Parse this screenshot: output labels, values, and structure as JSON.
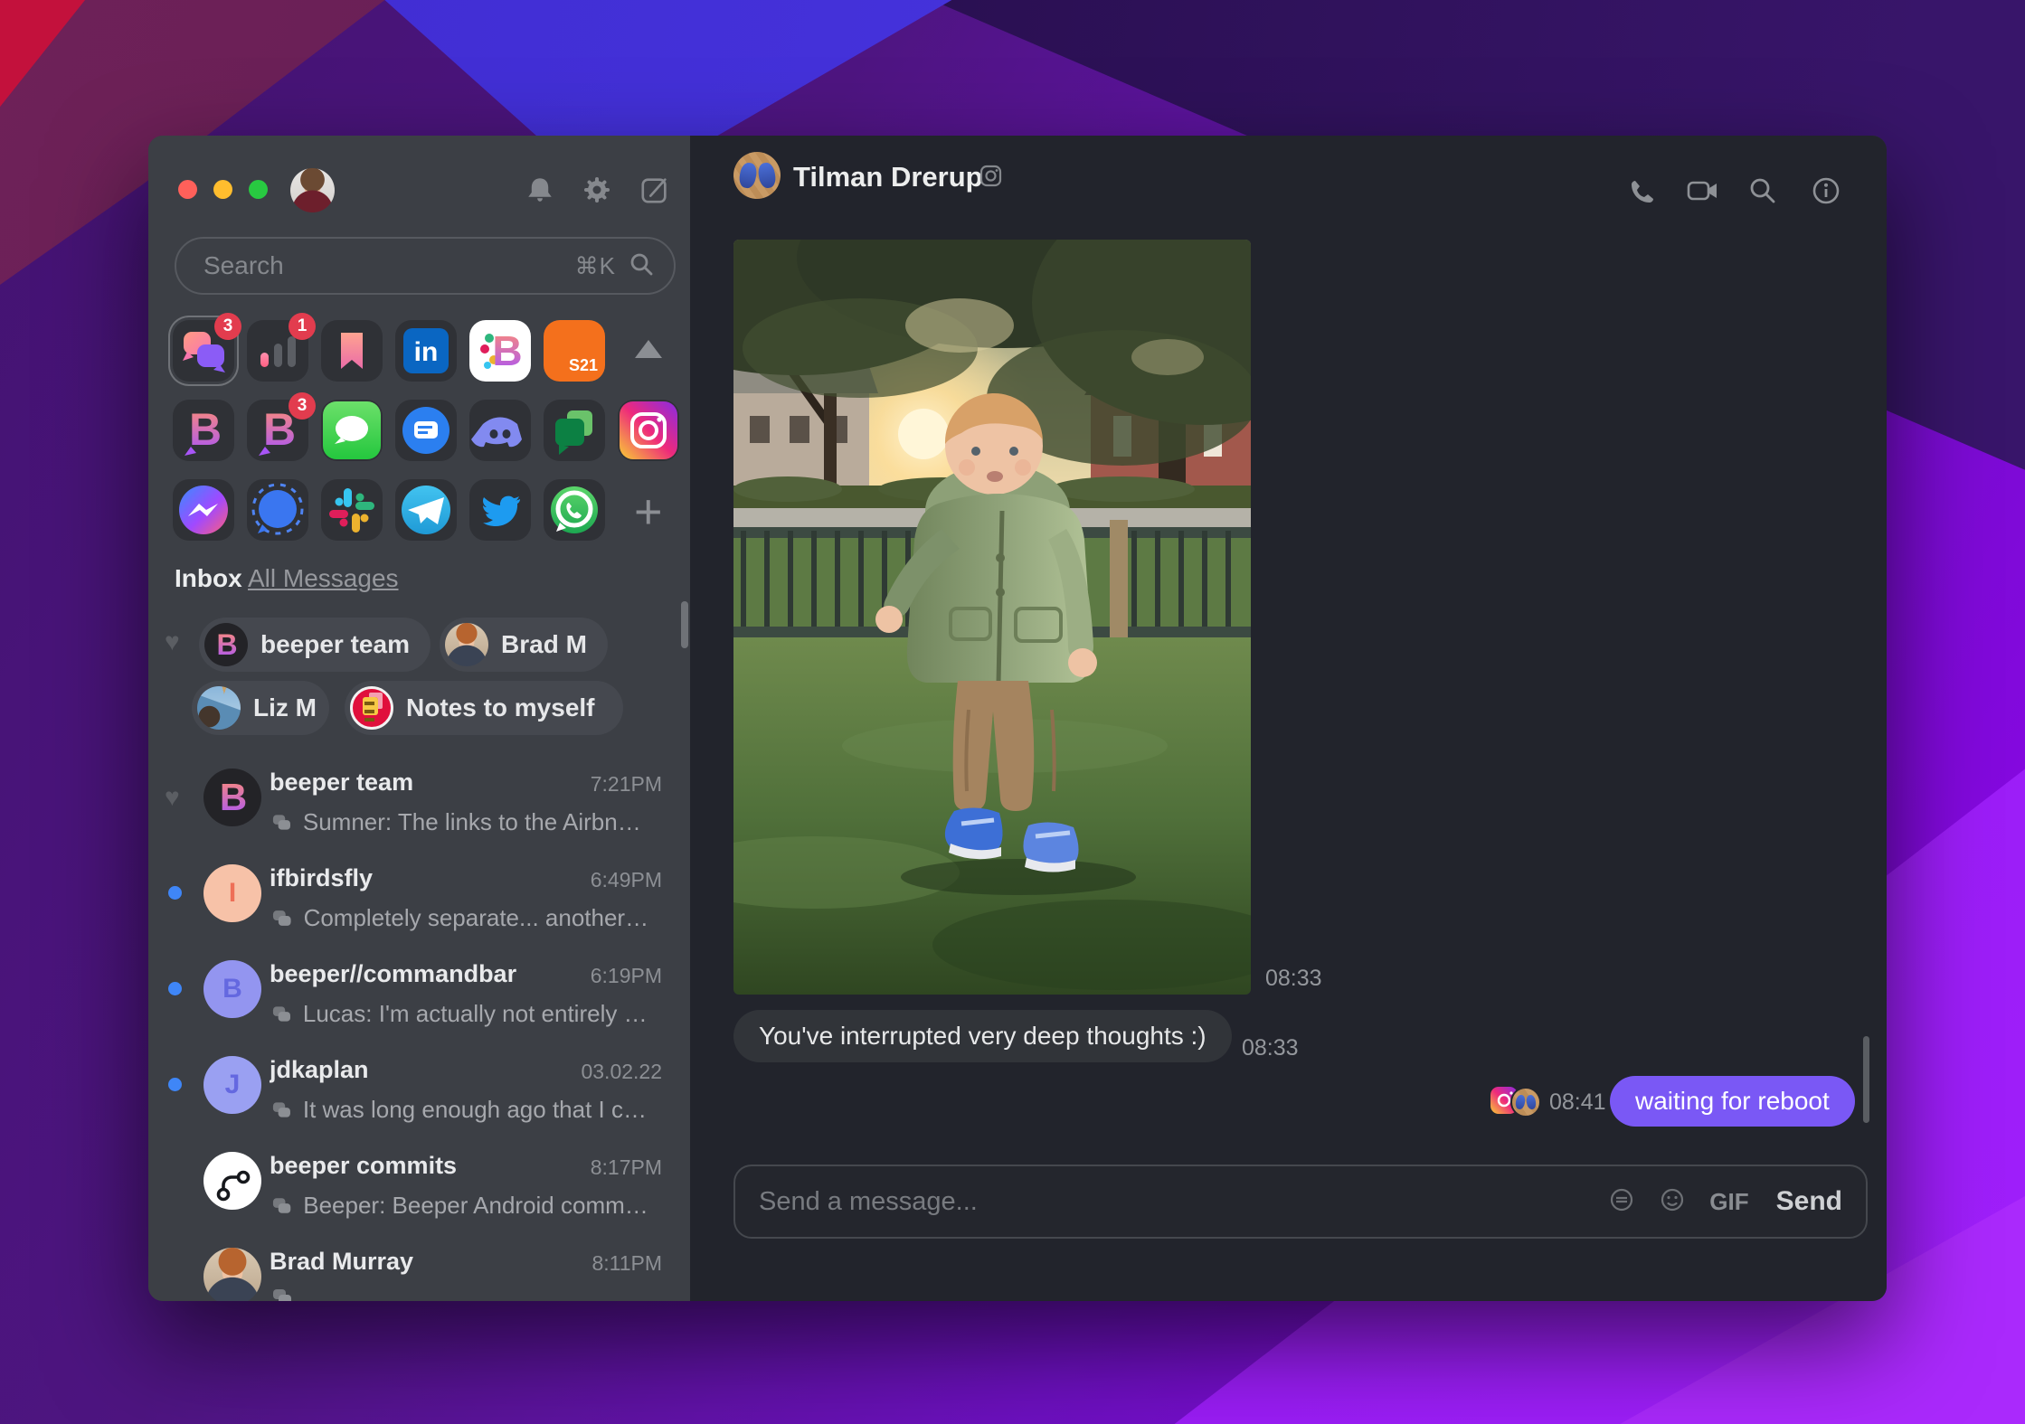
{
  "colors": {
    "send_bubble": "#7a58f5",
    "unread_dot": "#3f86f7",
    "badge_red": "#e23c4e",
    "sidebar_bg": "#3c3f45",
    "pane_bg": "#22242c"
  },
  "window": {
    "sidebar": {
      "search": {
        "placeholder": "Search",
        "shortcut": "⌘K"
      },
      "app_grid": {
        "badges": {
          "chats": "3",
          "analytics": "1",
          "beeper_alt": "3"
        },
        "s21_label": "S21"
      },
      "inbox_label": "Inbox",
      "all_messages_label": "All Messages",
      "favorites": [
        {
          "label": "beeper team"
        },
        {
          "label": "Brad M"
        },
        {
          "label": "Liz M"
        },
        {
          "label": "Notes to myself"
        }
      ],
      "chats": [
        {
          "name": "beeper team",
          "time": "7:21PM",
          "preview": "Sumner: The links to the Airbnbs ..."
        },
        {
          "name": "ifbirdsfly",
          "time": "6:49PM",
          "preview": "Completely separate... another r...",
          "avatar_letter": "I"
        },
        {
          "name": "beeper//commandbar",
          "time": "6:19PM",
          "preview": "Lucas: I'm actually not entirely su...",
          "avatar_letter": "B"
        },
        {
          "name": "jdkaplan",
          "time": "03.02.22",
          "preview": "It was long enough ago that I cou...",
          "avatar_letter": "J"
        },
        {
          "name": "beeper commits",
          "time": "8:17PM",
          "preview": "Beeper: Beeper Android commit ..."
        },
        {
          "name": "Brad Murray",
          "time": "8:11PM",
          "preview": ""
        }
      ]
    },
    "chat": {
      "header": {
        "title": "Tilman Drerup"
      },
      "messages": {
        "image_time": "08:33",
        "incoming_text": "You've interrupted very deep thoughts :)",
        "incoming_time": "08:33",
        "outgoing_text": "waiting for reboot",
        "outgoing_time": "08:41"
      },
      "composer": {
        "placeholder": "Send a message...",
        "gif_label": "GIF",
        "send_label": "Send"
      }
    }
  }
}
